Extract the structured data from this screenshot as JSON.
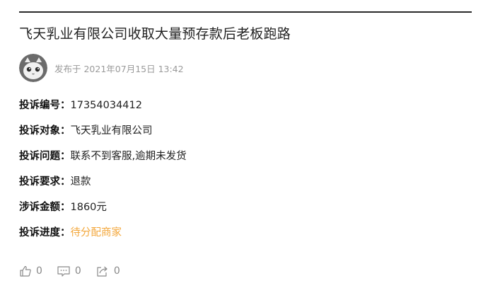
{
  "article": {
    "title": "飞天乳业有限公司收取大量预存款后老板跑路",
    "posted_at": "发布于 2021年07月15日 13:42"
  },
  "details": [
    {
      "label": "投诉编号：",
      "value": "17354034412"
    },
    {
      "label": "投诉对象：",
      "value": "飞天乳业有限公司"
    },
    {
      "label": "投诉问题：",
      "value": "联系不到客服,逾期未发货"
    },
    {
      "label": "投诉要求：",
      "value": "退款"
    },
    {
      "label": "涉诉金额：",
      "value": "1860元"
    },
    {
      "label": "投诉进度：",
      "value": "待分配商家"
    }
  ],
  "actions": {
    "like": {
      "icon": "thumbs-up-icon",
      "count": "0"
    },
    "comment": {
      "icon": "comment-icon",
      "count": "0"
    },
    "share": {
      "icon": "share-icon",
      "count": "0"
    }
  },
  "colors": {
    "status": "#f3a73b",
    "muted": "#9a9a9a"
  }
}
